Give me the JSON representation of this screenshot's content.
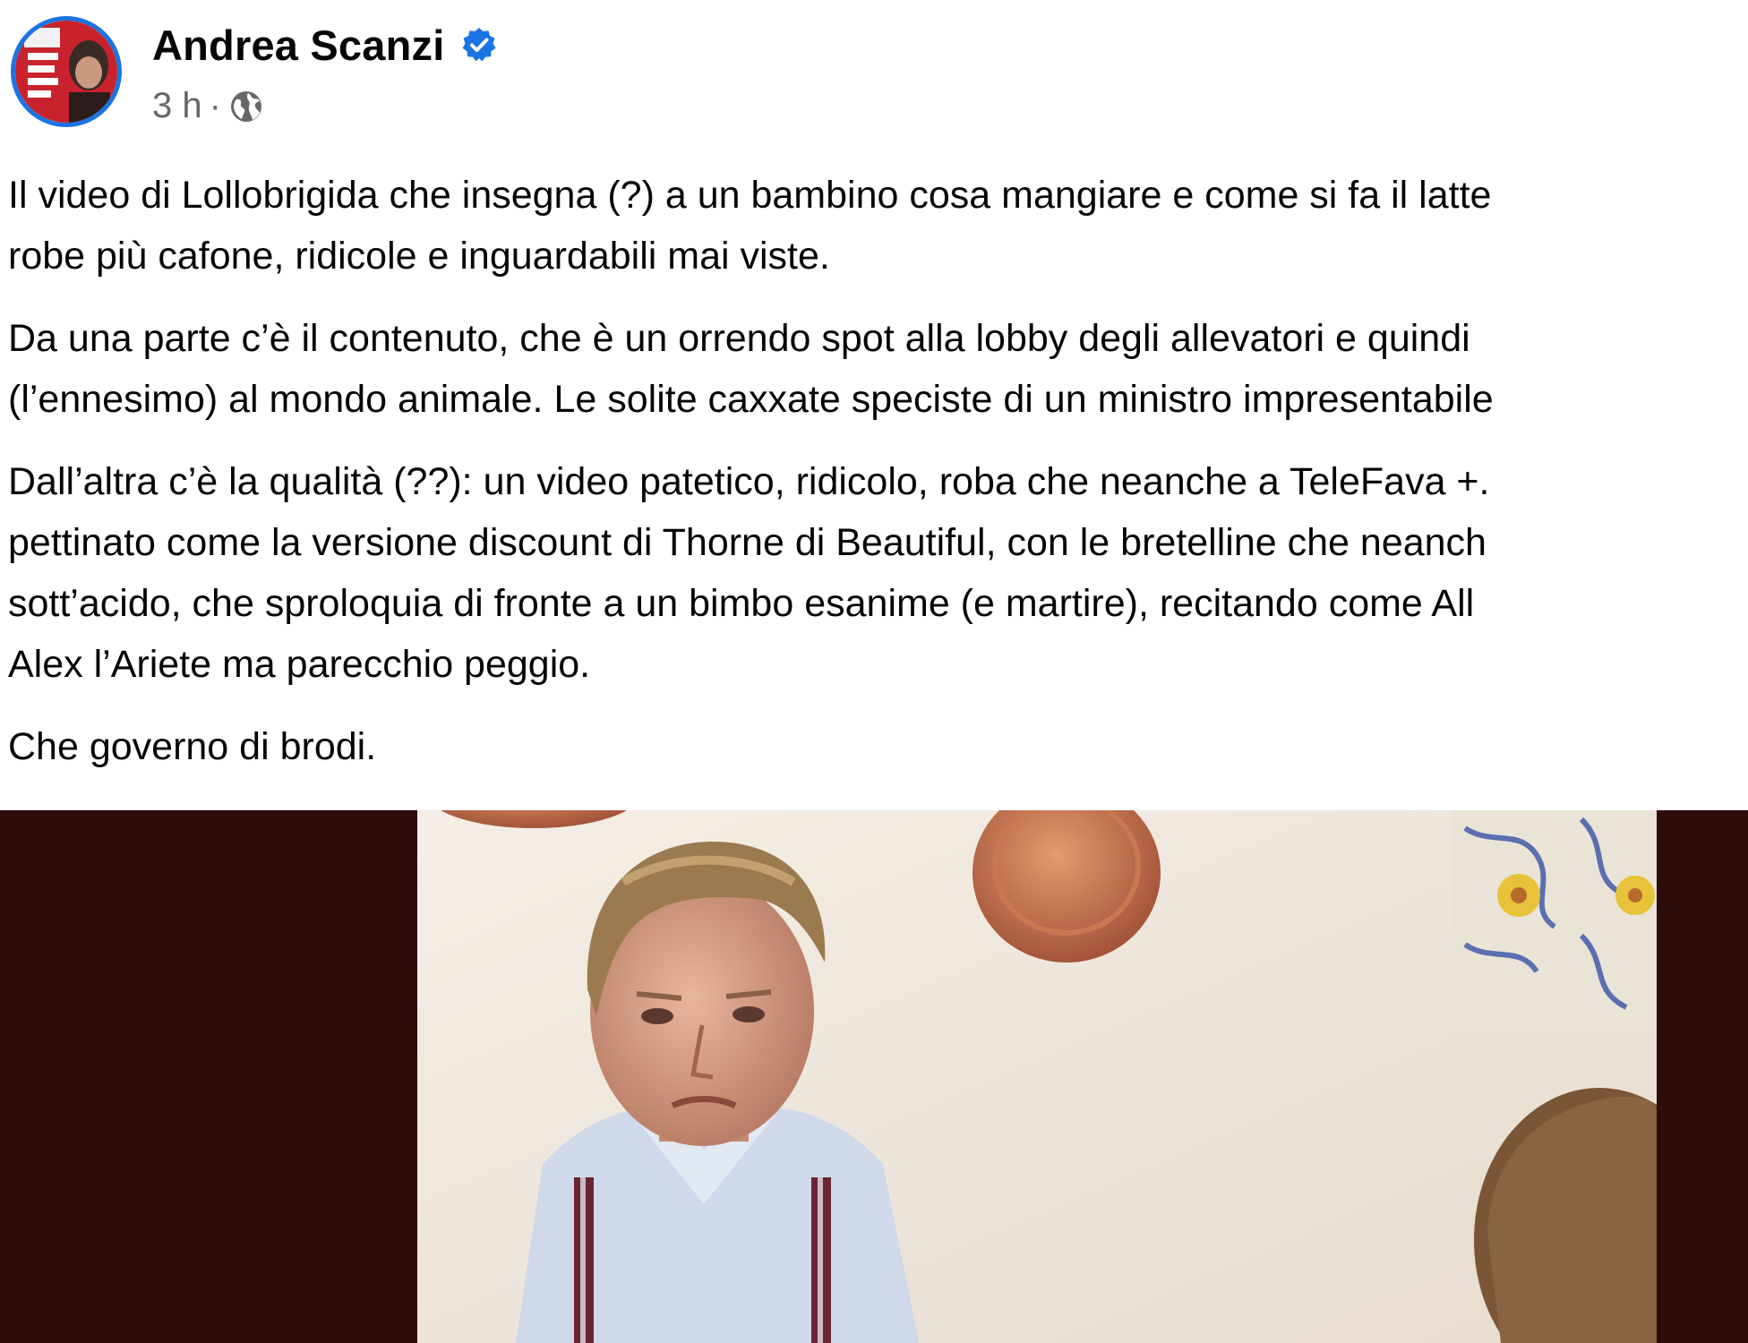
{
  "post": {
    "author": "Andrea Scanzi",
    "verified": true,
    "time": "3 h",
    "separator": "·",
    "audience_icon": "globe-icon",
    "paragraphs": [
      {
        "lines": [
          "Il video di Lollobrigida che insegna (?) a un bambino cosa mangiare e come si fa il latte",
          "robe più cafone, ridicole e inguardabili mai viste."
        ]
      },
      {
        "lines": [
          "Da una parte c’è il contenuto, che è un orrendo spot alla lobby degli allevatori e quindi",
          "(l’ennesimo) al mondo animale. Le solite caxxate speciste di un ministro impresentabile"
        ]
      },
      {
        "lines": [
          "Dall’altra c’è la qualità (??): un video patetico, ridicolo, roba che neanche a TeleFava +. ",
          "pettinato come la versione discount di Thorne di Beautiful, con le bretelline che neanch",
          "sott’acido, che sproloquia di fronte a un bimbo esanime (e martire), recitando come All",
          "Alex l’Ariete ma parecchio peggio."
        ]
      },
      {
        "lines": [
          "Che governo di brodi."
        ]
      }
    ]
  },
  "colors": {
    "verified_badge": "#1b74e4",
    "meta_text": "#65676b",
    "media_background": "#2d0c0c"
  }
}
